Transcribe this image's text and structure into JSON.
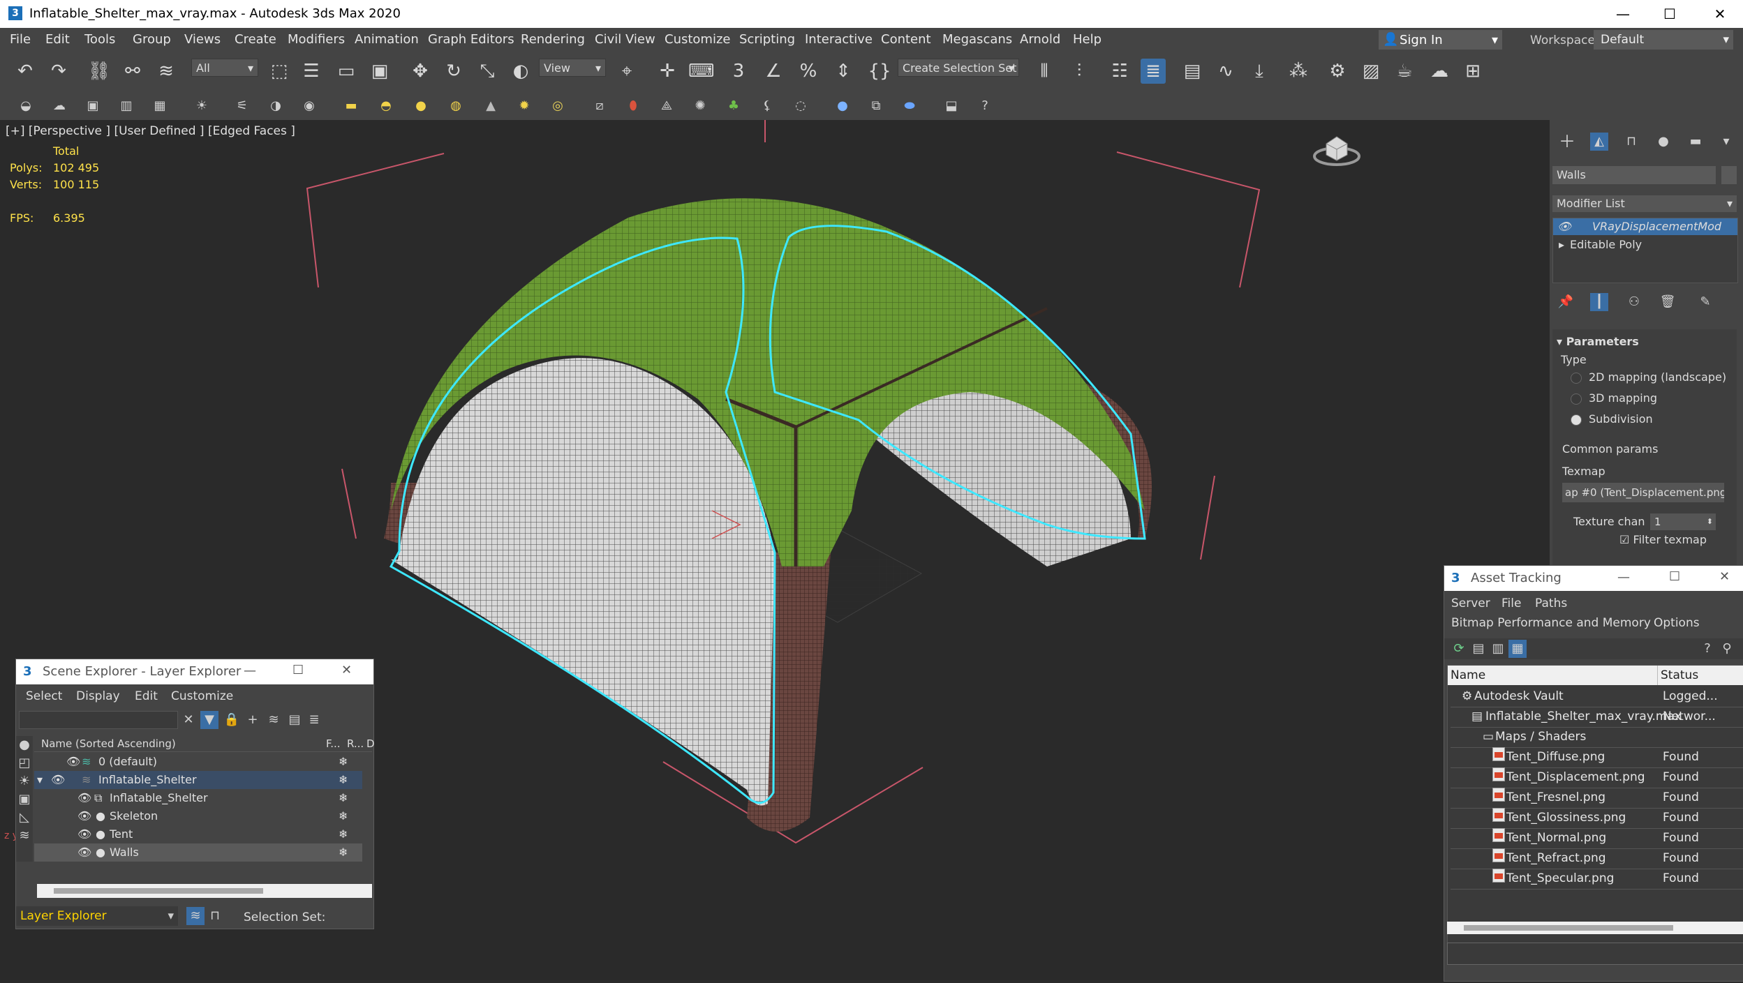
{
  "window": {
    "title": "Inflatable_Shelter_max_vray.max - Autodesk 3ds Max 2020",
    "app_icon": "3"
  },
  "menu": [
    "File",
    "Edit",
    "Tools",
    "Group",
    "Views",
    "Create",
    "Modifiers",
    "Animation",
    "Graph Editors",
    "Rendering",
    "Civil View",
    "Customize",
    "Scripting",
    "Interactive",
    "Content",
    "Megascans",
    "Arnold",
    "Help"
  ],
  "signin": {
    "label": "Sign In"
  },
  "workspaces": {
    "label": "Workspaces:",
    "value": "Default"
  },
  "toolbar": {
    "filter": "All",
    "ref_coord": "View",
    "selection_set": "Create Selection Set"
  },
  "viewport": {
    "label": "[+] [Perspective ] [User Defined ] [Edged Faces ]",
    "stats_total": "Total",
    "polys_label": "Polys:",
    "polys_value": "102 495",
    "verts_label": "Verts:",
    "verts_value": "100 115",
    "fps_label": "FPS:",
    "fps_value": "6.395",
    "colors": {
      "tent_green": "#6d9a34",
      "walls": "#cfcfcf",
      "frame": "#5a3a34",
      "selection": "#3ee8ff",
      "bbox": "#d05a6a"
    }
  },
  "command_panel": {
    "object_name": "Walls",
    "modifier_list": "Modifier List",
    "stack": [
      "VRayDisplacementMod",
      "Editable Poly"
    ],
    "rollout": "Parameters",
    "type_label": "Type",
    "types": [
      "2D mapping (landscape)",
      "3D mapping",
      "Subdivision"
    ],
    "selected_type": "Subdivision",
    "common_params": "Common params",
    "texmap_label": "Texmap",
    "texmap_value": "ap #0 (Tent_Displacement.png",
    "texture_chan_label": "Texture chan",
    "texture_chan_value": "1",
    "filter_texmap": "Filter texmap"
  },
  "scene_explorer": {
    "title": "Scene Explorer - Layer Explorer",
    "menu": [
      "Select",
      "Display",
      "Edit",
      "Customize"
    ],
    "columns": {
      "name": "Name (Sorted Ascending)",
      "freeze": "F...",
      "render": "R...",
      "d": "D"
    },
    "rows": [
      {
        "name": "0 (default)",
        "level": 0
      },
      {
        "name": "Inflatable_Shelter",
        "level": 0
      },
      {
        "name": "Inflatable_Shelter",
        "level": 1
      },
      {
        "name": "Skeleton",
        "level": 1
      },
      {
        "name": "Tent",
        "level": 1
      },
      {
        "name": "Walls",
        "level": 1
      }
    ],
    "footer_explorer": "Layer Explorer",
    "selection_set": "Selection Set:"
  },
  "asset_tracking": {
    "title": "Asset Tracking",
    "menu1": [
      "Server",
      "File",
      "Paths"
    ],
    "menu2": [
      "Bitmap Performance and Memory",
      "Options"
    ],
    "columns": {
      "name": "Name",
      "status": "Status"
    },
    "rows": [
      {
        "name": "Autodesk Vault",
        "status": "Logged...",
        "level": 0
      },
      {
        "name": "Inflatable_Shelter_max_vray.max",
        "status": "Networ...",
        "level": 1
      },
      {
        "name": "Maps / Shaders",
        "status": "",
        "level": 2
      },
      {
        "name": "Tent_Diffuse.png",
        "status": "Found",
        "level": 3
      },
      {
        "name": "Tent_Displacement.png",
        "status": "Found",
        "level": 3
      },
      {
        "name": "Tent_Fresnel.png",
        "status": "Found",
        "level": 3
      },
      {
        "name": "Tent_Glossiness.png",
        "status": "Found",
        "level": 3
      },
      {
        "name": "Tent_Normal.png",
        "status": "Found",
        "level": 3
      },
      {
        "name": "Tent_Refract.png",
        "status": "Found",
        "level": 3
      },
      {
        "name": "Tent_Specular.png",
        "status": "Found",
        "level": 3
      }
    ]
  }
}
